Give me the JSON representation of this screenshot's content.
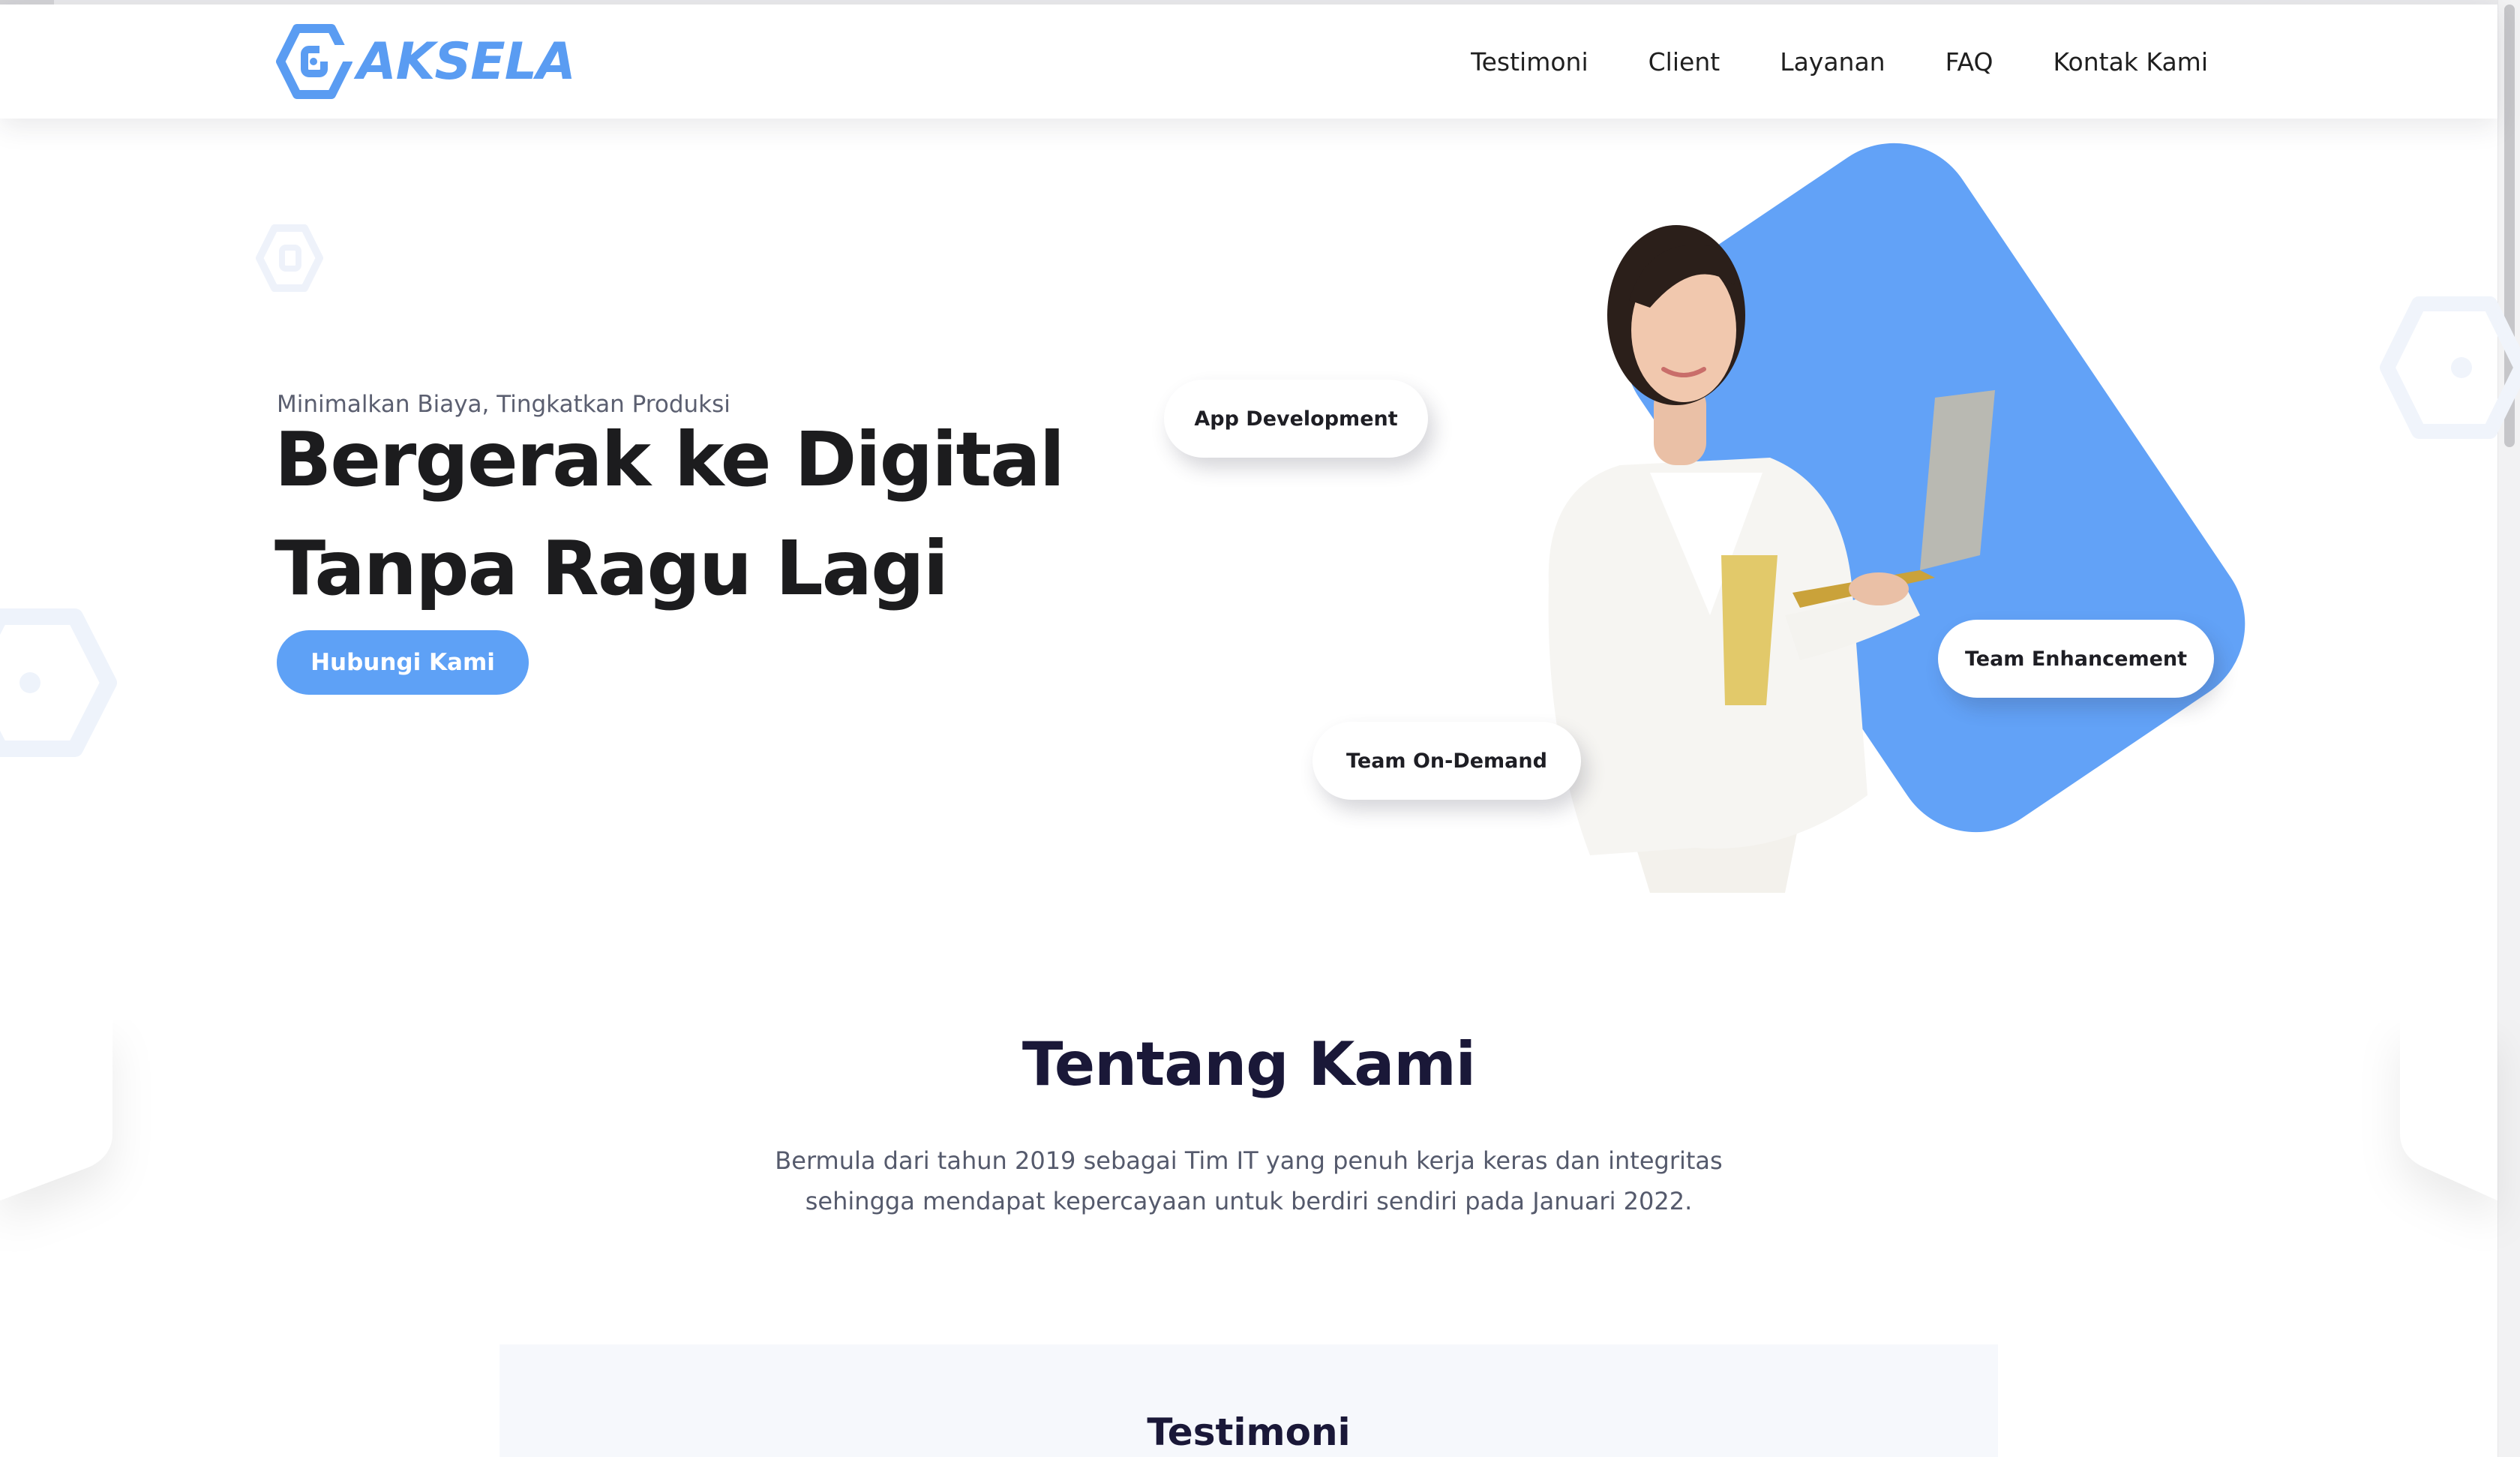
{
  "brand": {
    "name": "AKSELA",
    "logo_icon": "hexagon-logo-icon",
    "accent_color": "#5ea1f6"
  },
  "nav": {
    "items": [
      "Testimoni",
      "Client",
      "Layanan",
      "FAQ",
      "Kontak Kami"
    ]
  },
  "hero": {
    "eyebrow": "Minimalkan Biaya, Tingkatkan Produksi",
    "title_line1": "Bergerak ke Digital",
    "title_line2": "Tanpa Ragu Lagi",
    "cta_label": "Hubungi Kami",
    "illustration": "woman-with-laptop-illustration",
    "badges": {
      "app_development": "App Development",
      "team_enhancement": "Team Enhancement",
      "team_on_demand": "Team On-Demand"
    }
  },
  "about": {
    "title": "Tentang Kami",
    "text_line1": "Bermula dari tahun 2019 sebagai Tim IT yang penuh kerja keras dan integritas",
    "text_line2": "sehingga mendapat kepercayaan untuk berdiri sendiri pada Januari 2022."
  },
  "testimoni": {
    "title": "Testimoni"
  }
}
